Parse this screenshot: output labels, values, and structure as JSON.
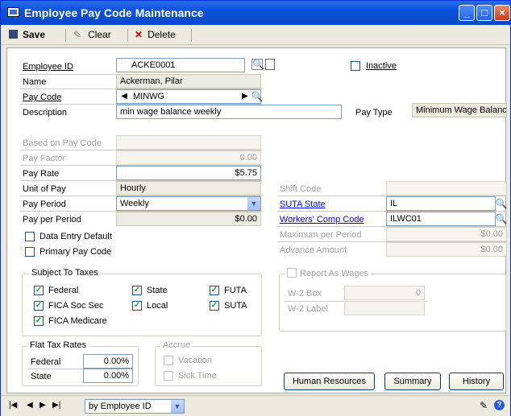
{
  "window": {
    "title": "Employee Pay Code Maintenance"
  },
  "toolbar": {
    "save": "Save",
    "clear": "Clear",
    "delete": "Delete"
  },
  "fields": {
    "employee_id_label": "Employee ID",
    "employee_id": "ACKE0001",
    "name_label": "Name",
    "name": "Ackerman, Pilar",
    "pay_code_label": "Pay Code",
    "pay_code": "MINWG",
    "description_label": "Description",
    "description": "min wage balance weekly",
    "pay_type_label": "Pay Type",
    "pay_type": "Minimum Wage Balance",
    "inactive_label": "Inactive",
    "based_on_label": "Based on Pay Code",
    "based_on": "",
    "pay_factor_label": "Pay Factor",
    "pay_factor": "0.00",
    "pay_rate_label": "Pay Rate",
    "pay_rate": "$5.75",
    "unit_of_pay_label": "Unit of Pay",
    "unit_of_pay": "Hourly",
    "pay_period_label": "Pay Period",
    "pay_period": "Weekly",
    "pay_per_period_label": "Pay per Period",
    "pay_per_period": "$0.00",
    "data_entry_default": "Data Entry Default",
    "primary_pay_code": "Primary Pay Code",
    "shift_code_label": "Shift Code",
    "shift_code": "",
    "suta_state_label": "SUTA State",
    "suta_state": "IL",
    "workers_comp_label": "Workers' Comp Code",
    "workers_comp": "ILWC01",
    "max_per_period_label": "Maximum per Period",
    "max_per_period": "$0.00",
    "advance_amount_label": "Advance Amount",
    "advance_amount": "$0.00"
  },
  "taxes": {
    "title": "Subject To Taxes",
    "federal": "Federal",
    "fica_ss": "FICA Soc Sec",
    "fica_med": "FICA Medicare",
    "state": "State",
    "local": "Local",
    "futa": "FUTA",
    "suta": "SUTA"
  },
  "report": {
    "title": "Report As Wages",
    "w2box_label": "W-2 Box",
    "w2box": "0",
    "w2label_label": "W-2 Label",
    "w2label": ""
  },
  "flat": {
    "title": "Flat Tax Rates",
    "federal_label": "Federal",
    "federal": "0.00%",
    "state_label": "State",
    "state": "0.00%"
  },
  "accrue": {
    "title": "Accrue",
    "vacation": "Vacation",
    "sick": "Sick Time"
  },
  "buttons": {
    "hr": "Human Resources",
    "summary": "Summary",
    "history": "History"
  },
  "status": {
    "sort": "by Employee ID"
  }
}
